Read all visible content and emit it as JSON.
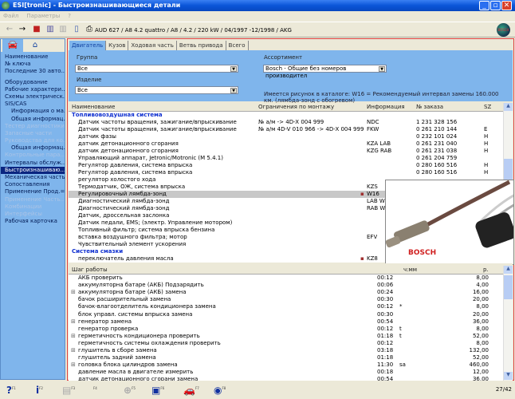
{
  "window": {
    "title": "ESI[tronic] - Быстроизнашивающиеся детали",
    "min": "_",
    "max": "▫",
    "close": "✕"
  },
  "menu": [
    "Файл",
    "Параметры",
    "?"
  ],
  "toolbar": {
    "vehicle": "AUD 627 / A8 4.2 quattro / A8 / 4.2 / 220 kW / 04/1997 -12/1998 / AKG",
    "globe_label": "BOSCH"
  },
  "sidebar": {
    "items": [
      {
        "label": "Наименование",
        "state": "normal"
      },
      {
        "label": "№ ключа",
        "state": "normal"
      },
      {
        "label": "Последние 30 авто...",
        "state": "normal"
      },
      {
        "label": "Оборудование",
        "state": "normal",
        "gap": true
      },
      {
        "label": "Рабочие характери...",
        "state": "normal"
      },
      {
        "label": "Схемы электрическ...",
        "state": "normal"
      },
      {
        "label": "SIS/CAS",
        "state": "normal"
      },
      {
        "label": "Информация о ма...",
        "state": "normal",
        "indent": true
      },
      {
        "label": "Общая информац...",
        "state": "normal",
        "indent": true
      },
      {
        "label": "Тестер диагностики",
        "state": "disabled"
      },
      {
        "label": "Запасные части",
        "state": "disabled"
      },
      {
        "label": "Руководства для ко...",
        "state": "disabled"
      },
      {
        "label": "Общая информац...",
        "state": "normal",
        "indent": true
      },
      {
        "label": "Контрольные пара...",
        "state": "disabled"
      },
      {
        "label": "Интервалы обслуж...",
        "state": "normal"
      },
      {
        "label": "Быстроизнашиваю...",
        "state": "selected"
      },
      {
        "label": "Механическая часть",
        "state": "normal"
      },
      {
        "label": "Сопоставления",
        "state": "normal"
      },
      {
        "label": "Применение Прод.=...",
        "state": "normal"
      },
      {
        "label": "Применение Часть...",
        "state": "disabled"
      },
      {
        "label": "Комбинации",
        "state": "disabled"
      },
      {
        "label": "Интерфейсы",
        "state": "disabled"
      },
      {
        "label": "Рабочая карточка",
        "state": "normal"
      }
    ]
  },
  "tabs": [
    {
      "label": "Двигатель",
      "active": true
    },
    {
      "label": "Кузов"
    },
    {
      "label": "Ходовая часть"
    },
    {
      "label": "Ветвь привода"
    },
    {
      "label": "Всего"
    }
  ],
  "filters": {
    "group_label": "Группа",
    "group_value": "Все",
    "product_label": "Изделие",
    "product_value": "Все",
    "assortment_label": "Ассортимент",
    "assortment_value": "Bosch - Общие без номеров производител",
    "note": "Имеется рисунок в каталоге: W16 = Рекомендуемый интервал замены 160.000 км. (лямбда-зонд с обогревом)"
  },
  "parts_table": {
    "headers": [
      "Наименование",
      "Ограничения по монтажу",
      "Информация",
      "№ заказа",
      "SZ"
    ],
    "rows": [
      {
        "group": true,
        "name": "Топливовоздушная система"
      },
      {
        "name": "Датчик частоты вращения, зажигание/впрыскивание",
        "limit": "№ а/м -> 4D-X 004 999",
        "info": "NDC",
        "order": "1 231 328 156",
        "sz": ""
      },
      {
        "name": "Датчик частоты вращения, зажигание/впрыскивание",
        "limit": "№ а/м 4D-V 010 966 -> 4D-X 004 999",
        "info": "FKW",
        "order": "0 261 210 144",
        "sz": "E"
      },
      {
        "name": "датчик фазы",
        "limit": "",
        "info": "",
        "order": "0 232 101 024",
        "sz": "H"
      },
      {
        "name": "датчик детонационного сгорания",
        "limit": "",
        "info": "KZA LAB",
        "order": "0 261 231 040",
        "sz": "H"
      },
      {
        "name": "датчик детонационного сгорания",
        "limit": "",
        "info": "KZG RAB",
        "order": "0 261 231 038",
        "sz": "H"
      },
      {
        "name": "Управляющий аппарат, Jetronic/Motronic (M 5.4.1)",
        "limit": "",
        "info": "",
        "order": "0 261 204 759",
        "sz": ""
      },
      {
        "name": "Регулятор давления, система впрыска",
        "limit": "",
        "info": "",
        "order": "0 280 160 516",
        "sz": "H"
      },
      {
        "name": "Регулятор давления, система впрыска",
        "limit": "",
        "info": "",
        "order": "0 280 160 516",
        "sz": "H"
      },
      {
        "name": "регулятор холостого хода",
        "limit": "",
        "info": "",
        "order": "",
        "sz": ""
      },
      {
        "name": "Термодатчик, ОЖ, система впрыска",
        "limit": "",
        "info": "KZS",
        "order": "",
        "sz": ""
      },
      {
        "name": "Регулировочный лямбда-зонд",
        "limit": "",
        "info": "W16",
        "order": "",
        "sz": "",
        "selected": true,
        "camera": true
      },
      {
        "name": "Диагностический лямбда-зонд",
        "limit": "",
        "info": "LAB W",
        "order": "",
        "sz": ""
      },
      {
        "name": "Диагностический лямбда-зонд",
        "limit": "",
        "info": "RAB W",
        "order": "",
        "sz": ""
      },
      {
        "name": "Датчик, дроссельная заслонка",
        "limit": "",
        "info": "",
        "order": "",
        "sz": ""
      },
      {
        "name": "Датчик педали, EMS; (электр. Управление мотором)",
        "limit": "",
        "info": "",
        "order": "",
        "sz": ""
      },
      {
        "name": "Топливный фильтр; система впрыска бензина",
        "limit": "",
        "info": "",
        "order": "",
        "sz": ""
      },
      {
        "name": "вставка воздушного фильтра; мотор",
        "limit": "",
        "info": "EFV",
        "order": "",
        "sz": ""
      },
      {
        "name": "Чувствительный элемент ускорения",
        "limit": "",
        "info": "",
        "order": "",
        "sz": ""
      },
      {
        "group": true,
        "name": "Система смазки"
      },
      {
        "name": "переключатель давления масла",
        "limit": "",
        "info": "KZ8",
        "order": "",
        "sz": "",
        "camera": true
      }
    ]
  },
  "photo": {
    "brand": "BOSCH"
  },
  "labor_table": {
    "headers": [
      "Шаг работы",
      "ч:мм",
      "р."
    ],
    "rows": [
      {
        "name": "АКБ проверить",
        "time": "00:12",
        "flag": "",
        "price": "8,00"
      },
      {
        "name": "аккумуляторна батаре (АКБ) Подзарядить",
        "time": "00:06",
        "flag": "",
        "price": "4,00"
      },
      {
        "name": "аккумуляторна батаре (АКБ) замена",
        "time": "00:24",
        "flag": "",
        "price": "16,00",
        "expand": true
      },
      {
        "name": "бачок расширительный замена",
        "time": "00:30",
        "flag": "",
        "price": "20,00"
      },
      {
        "name": "бачок-влагоотделитель кондиционера замена",
        "time": "00:12",
        "flag": "*",
        "price": "8,00"
      },
      {
        "name": "блок управл. системы впрыска замена",
        "time": "00:30",
        "flag": "",
        "price": "20,00"
      },
      {
        "name": "генератор замена",
        "time": "00:54",
        "flag": "",
        "price": "36,00",
        "expand": true
      },
      {
        "name": "генератор проверка",
        "time": "00:12",
        "flag": "t",
        "price": "8,00"
      },
      {
        "name": "герметичность кондиционера проверить",
        "time": "01:18",
        "flag": "t",
        "price": "52,00",
        "expand": true
      },
      {
        "name": "герметичность системы охлаждения проверить",
        "time": "00:12",
        "flag": "",
        "price": "8,00"
      },
      {
        "name": "глушитель в сборе замена",
        "time": "03:18",
        "flag": "",
        "price": "132,00",
        "expand": true
      },
      {
        "name": "глушитель задний замена",
        "time": "01:18",
        "flag": "",
        "price": "52,00"
      },
      {
        "name": "головка блока цилиндров замена",
        "time": "11:30",
        "flag": "sa",
        "price": "460,00",
        "expand": true
      },
      {
        "name": "давление масла в двигателе измерить",
        "time": "00:18",
        "flag": "",
        "price": "12,00"
      },
      {
        "name": "датчик детонационного сгорани замена",
        "time": "00:54",
        "flag": "",
        "price": "36,00"
      }
    ]
  },
  "statusbar": {
    "keys": [
      {
        "glyph": "?",
        "key": "F1"
      },
      {
        "glyph": "i",
        "key": "F2"
      },
      {
        "glyph": "▤",
        "key": "F3"
      },
      {
        "glyph": "",
        "key": "F4"
      },
      {
        "glyph": "⊕",
        "key": "F5"
      },
      {
        "glyph": "▣",
        "key": "F6"
      },
      {
        "glyph": "🚗",
        "key": "F7"
      },
      {
        "glyph": "◉",
        "key": "F8"
      }
    ],
    "page": "27/42"
  },
  "colors": {
    "panel": "#7fb5ec",
    "selected": "#0a2580",
    "group_text": "#1030d0",
    "frame": "#e04040"
  }
}
